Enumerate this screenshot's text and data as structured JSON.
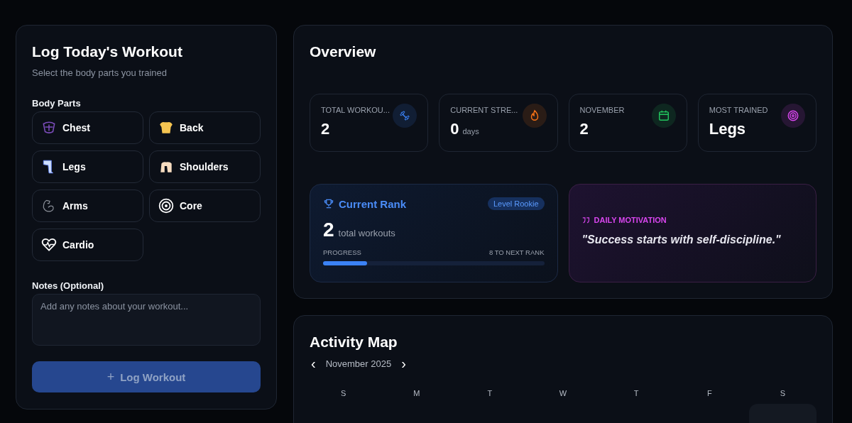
{
  "log_panel": {
    "title": "Log Today's Workout",
    "subtitle": "Select the body parts you trained",
    "body_parts_label": "Body Parts",
    "body_parts": [
      {
        "label": "Chest",
        "kind": "chest",
        "selected": false
      },
      {
        "label": "Back",
        "kind": "back",
        "selected": false
      },
      {
        "label": "Legs",
        "kind": "legs",
        "selected": false
      },
      {
        "label": "Shoulders",
        "kind": "shoulders",
        "selected": false
      },
      {
        "label": "Arms",
        "kind": "arms",
        "selected": false
      },
      {
        "label": "Core",
        "kind": "core",
        "selected": false
      },
      {
        "label": "Cardio",
        "kind": "cardio",
        "selected": false
      }
    ],
    "notes_label": "Notes (Optional)",
    "notes_placeholder": "Add any notes about your workout...",
    "submit": {
      "icon": "+",
      "label": "Log Workout",
      "disabled": true
    }
  },
  "overview": {
    "title": "Overview",
    "stats": [
      {
        "label": "TOTAL WORKOU...",
        "value": "2",
        "kind": "dumbbell",
        "color": "#3b82f6"
      },
      {
        "label": "CURRENT STRE...",
        "value": "0",
        "unit": "days",
        "kind": "flame",
        "color": "#f97316"
      },
      {
        "label": "NOVEMBER",
        "value": "2",
        "kind": "calendar",
        "color": "#22c55e"
      },
      {
        "label": "MOST TRAINED",
        "value": "Legs",
        "kind": "target",
        "color": "#d946ef"
      }
    ],
    "rank": {
      "title": "Current Rank",
      "badge": "Level Rookie",
      "value": "2",
      "value_label": "total workouts",
      "progress_label": "PROGRESS",
      "next_label": "8 TO NEXT RANK",
      "level": 0.2
    },
    "motivation": {
      "label": "DAILY MOTIVATION",
      "quote": "\"Success starts with self-discipline.\""
    }
  },
  "activity": {
    "title": "Activity Map",
    "prev": "‹",
    "month": "November 2025",
    "next": "›",
    "weekdays": [
      "S",
      "M",
      "T",
      "W",
      "T",
      "F",
      "S"
    ]
  }
}
